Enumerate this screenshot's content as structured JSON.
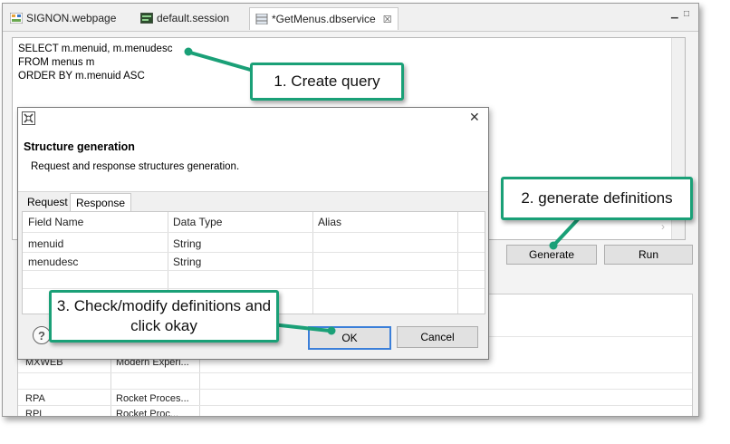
{
  "tabs": [
    {
      "label": "SIGNON.webpage",
      "icon": "webpage-icon"
    },
    {
      "label": "default.session",
      "icon": "session-icon"
    },
    {
      "label": "*GetMenus.dbservice",
      "icon": "dbservice-icon",
      "close": "☒"
    }
  ],
  "window_controls": {
    "minimize": "▁",
    "maximize": "□"
  },
  "editor": {
    "sql": "SELECT m.menuid, m.menudesc\nFROM menus m\nORDER BY m.menuid ASC"
  },
  "buttons": {
    "generate": "Generate",
    "run": "Run"
  },
  "lower_grid": {
    "rows": [
      {
        "c1": "MXWEB",
        "c2": "Modern Experi..."
      },
      {
        "c1": "RPA",
        "c2": "Rocket Proces..."
      },
      {
        "c1": "RPL",
        "c2": "Rocket Proc..."
      }
    ]
  },
  "dialog": {
    "title": "",
    "close": "✕",
    "heading": "Structure generation",
    "description": "Request and response structures generation.",
    "tabs": {
      "request": "Request",
      "response": "Response"
    },
    "columns": [
      "Field Name",
      "Data Type",
      "Alias"
    ],
    "rows": [
      {
        "field": "menuid",
        "type": "String",
        "alias": ""
      },
      {
        "field": "menudesc",
        "type": "String",
        "alias": ""
      }
    ],
    "help": "?",
    "ok": "OK",
    "cancel": "Cancel"
  },
  "callouts": {
    "one": "1. Create query",
    "two": "2. generate definitions",
    "three": "3. Check/modify definitions and click okay"
  },
  "colors": {
    "callout_border": "#1aa077",
    "dialog_bg": "#f0f0f0"
  }
}
